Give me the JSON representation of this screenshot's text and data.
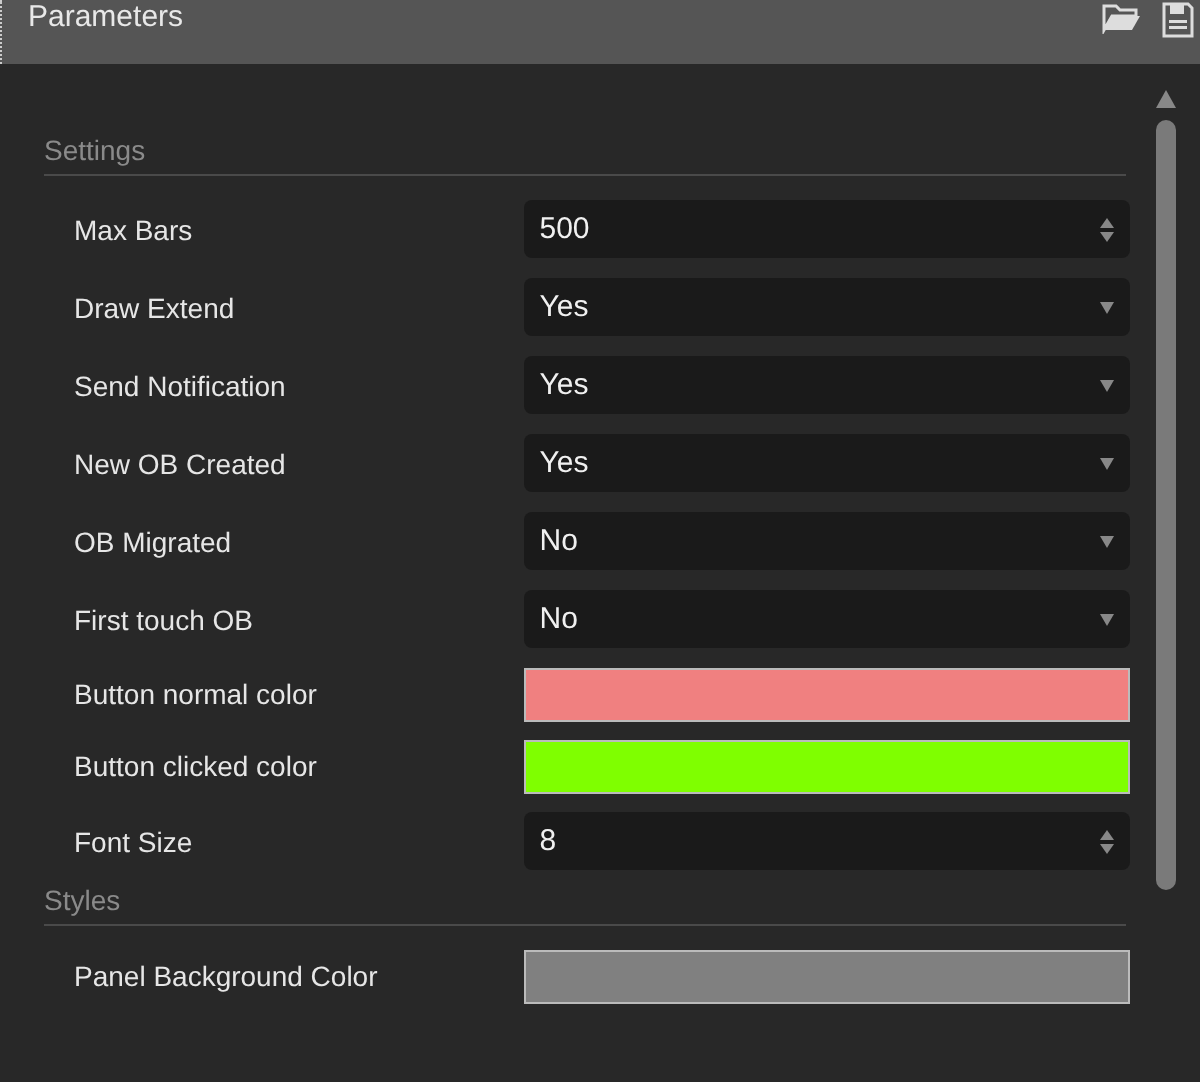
{
  "panel": {
    "title": "Parameters"
  },
  "sections": [
    {
      "title": "Settings",
      "params": [
        {
          "label": "Max Bars",
          "kind": "spin",
          "value": "500"
        },
        {
          "label": "Draw Extend",
          "kind": "select",
          "value": "Yes"
        },
        {
          "label": "Send Notification",
          "kind": "select",
          "value": "Yes"
        },
        {
          "label": "New OB Created",
          "kind": "select",
          "value": "Yes"
        },
        {
          "label": "OB Migrated",
          "kind": "select",
          "value": "No"
        },
        {
          "label": "First touch OB",
          "kind": "select",
          "value": "No"
        },
        {
          "label": "Button normal color",
          "kind": "color",
          "color": "#f08080"
        },
        {
          "label": "Button clicked color",
          "kind": "color",
          "color": "#7fff00"
        },
        {
          "label": "Font Size",
          "kind": "spin",
          "value": "8"
        }
      ]
    },
    {
      "title": "Styles",
      "params": [
        {
          "label": "Panel Background Color",
          "kind": "color",
          "color": "#808080"
        }
      ]
    }
  ]
}
